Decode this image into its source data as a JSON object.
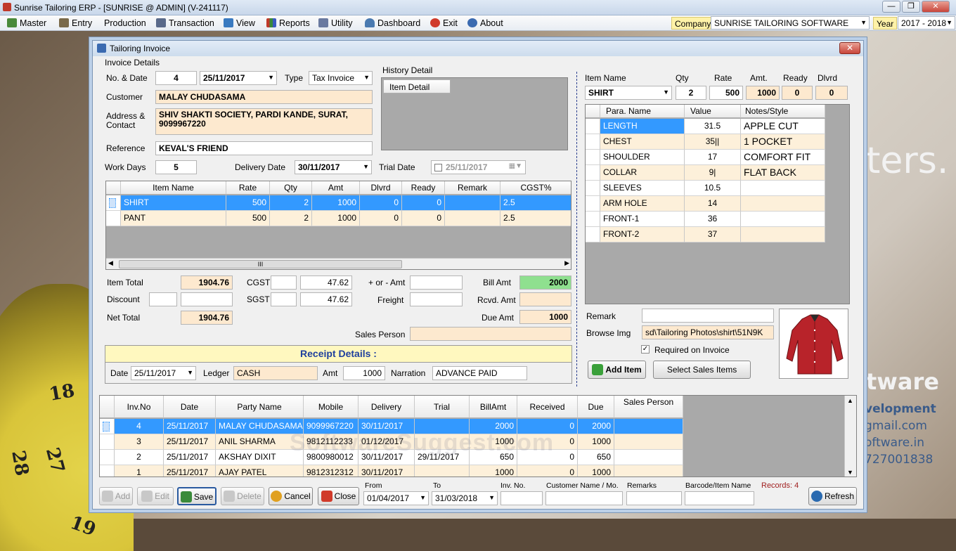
{
  "window_title": "Sunrise Tailoring ERP - [SUNRISE @ ADMIN] (V-241117)",
  "menu": [
    "Master",
    "Entry",
    "Production",
    "Transaction",
    "View",
    "Reports",
    "Utility",
    "Dashboard",
    "Exit",
    "About"
  ],
  "company_label": "Company",
  "company_value": "SUNRISE TAILORING SOFTWARE",
  "year_label": "Year",
  "year_value": "2017 - 2018",
  "background": {
    "text1": "ters.",
    "text2": "tware",
    "text3": "velopment",
    "text4": "gmail.com",
    "text5": "oftware.in",
    "text6": "727001838",
    "tape_numbers": [
      "18",
      "27",
      "28",
      "19"
    ],
    "watermark": "SoftwareSuggest.com"
  },
  "dialog": {
    "title": "Tailoring Invoice",
    "invoice_details_label": "Invoice Details",
    "no_date_label": "No. & Date",
    "invoice_no": "4",
    "invoice_date": "25/11/2017",
    "type_label": "Type",
    "type_value": "Tax Invoice",
    "customer_label": "Customer",
    "customer_value": "MALAY CHUDASAMA",
    "address_label": "Address &",
    "address_label2": "Contact",
    "address_line1": "SHIV SHAKTI SOCIETY, PARDI KANDE, SURAT,",
    "address_line2": "9099967220",
    "reference_label": "Reference",
    "reference_value": "KEVAL'S FRIEND",
    "work_days_label": "Work Days",
    "work_days_value": "5",
    "delivery_date_label": "Delivery Date",
    "delivery_date_value": "30/11/2017",
    "trial_date_label": "Trial Date",
    "trial_date_value": "25/11/2017",
    "history_label": "History Detail",
    "history_tab": "Item Detail"
  },
  "items_grid": {
    "headers": [
      "Item Name",
      "Rate",
      "Qty",
      "Amt",
      "Dlvrd",
      "Ready",
      "Remark",
      "CGST%"
    ],
    "rows": [
      [
        "SHIRT",
        "500",
        "2",
        "1000",
        "0",
        "0",
        "",
        "2.5"
      ],
      [
        "PANT",
        "500",
        "2",
        "1000",
        "0",
        "0",
        "",
        "2.5"
      ]
    ],
    "scroll_glyph": "III"
  },
  "totals": {
    "item_total_label": "Item Total",
    "item_total": "1904.76",
    "discount_label": "Discount",
    "net_total_label": "Net Total",
    "net_total": "1904.76",
    "cgst_label": "CGST",
    "cgst_amt": "47.62",
    "sgst_label": "SGST",
    "sgst_amt": "47.62",
    "plusminus_label": "+ or - Amt",
    "freight_label": "Freight",
    "bill_amt_label": "Bill Amt",
    "bill_amt": "2000",
    "rcvd_amt_label": "Rcvd. Amt",
    "due_amt_label": "Due Amt",
    "due_amt": "1000",
    "sales_person_label": "Sales Person"
  },
  "receipt": {
    "title": "Receipt Details :",
    "date_label": "Date",
    "date_value": "25/11/2017",
    "ledger_label": "Ledger",
    "ledger_value": "CASH",
    "amt_label": "Amt",
    "amt_value": "1000",
    "narration_label": "Narration",
    "narration_value": "ADVANCE PAID"
  },
  "item_entry": {
    "item_name_label": "Item Name",
    "qty_label": "Qty",
    "rate_label": "Rate",
    "amt_label": "Amt.",
    "ready_label": "Ready",
    "dlvrd_label": "Dlvrd",
    "item_name": "SHIRT",
    "qty": "2",
    "rate": "500",
    "amt": "1000",
    "ready": "0",
    "dlvrd": "0"
  },
  "param_grid": {
    "headers": [
      "Para. Name",
      "Value",
      "Notes/Style"
    ],
    "rows": [
      [
        "LENGTH",
        "31.5",
        "APPLE CUT"
      ],
      [
        "CHEST",
        "35||",
        "1 POCKET"
      ],
      [
        "SHOULDER",
        "17",
        "COMFORT FIT"
      ],
      [
        "COLLAR",
        "9|",
        "FLAT BACK"
      ],
      [
        "SLEEVES",
        "10.5",
        ""
      ],
      [
        "ARM HOLE",
        "14",
        ""
      ],
      [
        "FRONT-1",
        "36",
        ""
      ],
      [
        "FRONT-2",
        "37",
        ""
      ]
    ]
  },
  "remark_label": "Remark",
  "browse_img_label": "Browse Img",
  "browse_img_value": "sd\\Tailoring Photos\\shirt\\51N9K",
  "required_on_invoice": "Required on Invoice",
  "add_item_button": "Add Item",
  "select_sales_items_button": "Select Sales Items",
  "invoice_list": {
    "headers": [
      "Inv.No",
      "Date",
      "Party Name",
      "Mobile",
      "Delivery",
      "Trial",
      "BillAmt",
      "Received",
      "Due",
      "Sales Person"
    ],
    "rows": [
      [
        "4",
        "25/11/2017",
        "MALAY CHUDASAMA",
        "9099967220",
        "30/11/2017",
        "",
        "2000",
        "0",
        "2000",
        ""
      ],
      [
        "3",
        "25/11/2017",
        "ANIL SHARMA",
        "9812112233",
        "01/12/2017",
        "",
        "1000",
        "0",
        "1000",
        ""
      ],
      [
        "2",
        "25/11/2017",
        "AKSHAY DIXIT",
        "9800980012",
        "30/11/2017",
        "29/11/2017",
        "650",
        "0",
        "650",
        ""
      ],
      [
        "1",
        "25/11/2017",
        "AJAY PATEL",
        "9812312312",
        "30/11/2017",
        "",
        "1000",
        "0",
        "1000",
        ""
      ]
    ]
  },
  "bottom": {
    "add": "Add",
    "edit": "Edit",
    "save": "Save",
    "delete": "Delete",
    "cancel": "Cancel",
    "close": "Close",
    "from_label": "From",
    "from_value": "01/04/2017",
    "to_label": "To",
    "to_value": "31/03/2018",
    "invno_label": "Inv. No.",
    "custname_label": "Customer Name / Mo.",
    "remarks_label": "Remarks",
    "barcode_label": "Barcode/Item Name",
    "records": "Records: 4",
    "refresh": "Refresh"
  },
  "colors": {
    "accent_blue": "#3399ff",
    "peach": "#fde9cf",
    "green": "#8fe08f",
    "receipt_bg": "#fff8bf",
    "receipt_title": "#1e3f9e",
    "records_red": "#a02020"
  }
}
